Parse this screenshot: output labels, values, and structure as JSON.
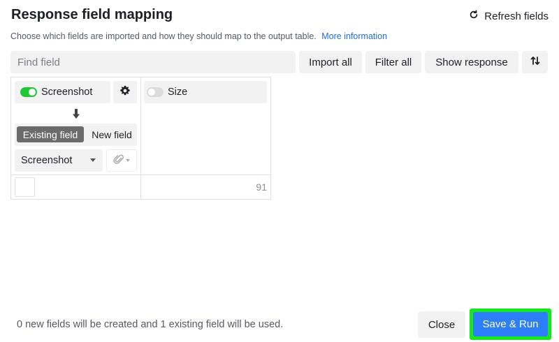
{
  "header": {
    "title": "Response field mapping",
    "refresh_label": "Refresh fields",
    "subtitle": "Choose which fields are imported and how they should map to the output table.",
    "more_info_link": "More information"
  },
  "toolbar": {
    "search_placeholder": "Find field",
    "import_all": "Import all",
    "filter_all": "Filter all",
    "show_response": "Show response",
    "sort_icon": "sort-arrows-icon"
  },
  "mapping": {
    "fields": [
      {
        "name": "Screenshot",
        "enabled": true,
        "mode_options": [
          "Existing field",
          "New field"
        ],
        "selected_mode": "Existing field",
        "target_field": "Screenshot",
        "field_type_icon": "paperclip-icon"
      },
      {
        "name": "Size",
        "enabled": false,
        "preview_value": "91"
      }
    ]
  },
  "footer": {
    "summary": "0 new fields will be created and 1 existing field will be used.",
    "close_label": "Close",
    "save_label": "Save & Run"
  },
  "colors": {
    "accent": "#2d7ff9",
    "toggle_on": "#20c933",
    "link": "#1f6fe5",
    "highlight": "#15e81c"
  }
}
